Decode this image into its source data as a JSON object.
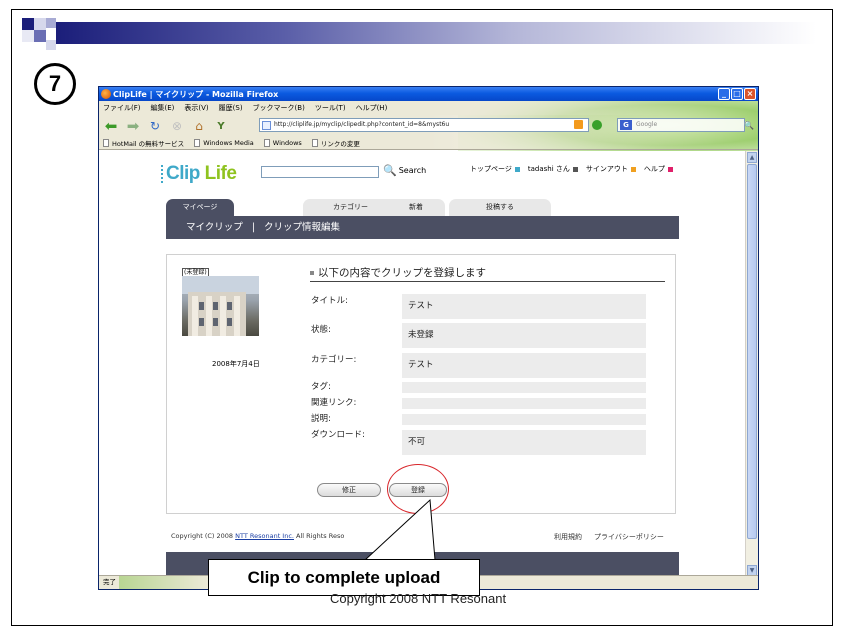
{
  "slide": {
    "step_number": "7",
    "callout_text": "Clip to complete upload",
    "footer_text": "Copyright 2008 NTT Resonant"
  },
  "browser": {
    "title": "ClipLife | マイクリップ - Mozilla Firefox",
    "menu": [
      "ファイル(F)",
      "編集(E)",
      "表示(V)",
      "履歴(S)",
      "ブックマーク(B)",
      "ツール(T)",
      "ヘルプ(H)"
    ],
    "url": "http://cliplife.jp/myclip/clipedit.php?content_id=8&myst6u",
    "search_placeholder": "Google",
    "bookmarks": [
      "HotMail の無料サービス",
      "Windows Media",
      "Windows",
      "リンクの変更"
    ],
    "status_text": "完了"
  },
  "site": {
    "logo_part1": "Clip",
    "logo_part2": " Life",
    "search_label": "Search",
    "top_links": [
      {
        "label": "トップページ",
        "color": "#3fa9c9"
      },
      {
        "label": "tadashi さん",
        "color": "#555555"
      },
      {
        "label": "サインアウト",
        "color": "#f0a020"
      },
      {
        "label": "ヘルプ",
        "color": "#e0206a"
      }
    ],
    "tabs": [
      "マイページ",
      "カテゴリー",
      "新着",
      "投稿する"
    ],
    "nav_strip": {
      "item1": "マイクリップ",
      "separator": "|",
      "item2": "クリップ情報編集"
    }
  },
  "form": {
    "heading": "以下の内容でクリップを登録します",
    "thumbnail_badge": "(未登録)",
    "thumbnail_date": "2008年7月4日",
    "fields": [
      {
        "label": "タイトル:",
        "value": "テスト"
      },
      {
        "label": "状態:",
        "value": "未登録"
      },
      {
        "label": "カテゴリー:",
        "value": "テスト"
      },
      {
        "label": "タグ:",
        "value": ""
      },
      {
        "label": "関連リンク:",
        "value": ""
      },
      {
        "label": "説明:",
        "value": ""
      },
      {
        "label": "ダウンロード:",
        "value": "不可"
      }
    ],
    "edit_button": "修正",
    "register_button": "登録"
  },
  "footer": {
    "copyright_prefix": "Copyright (C) 2008 ",
    "copyright_link": "NTT Resonant Inc.",
    "copyright_suffix": " All Rights Reso",
    "links": [
      "利用規約",
      "プライバシーポリシー"
    ]
  },
  "colors": {
    "nav_dark": "#4b4f63",
    "logo_green": "#8fc31f",
    "logo_blue": "#3fa9c9",
    "highlight_ring": "#d8262b"
  }
}
